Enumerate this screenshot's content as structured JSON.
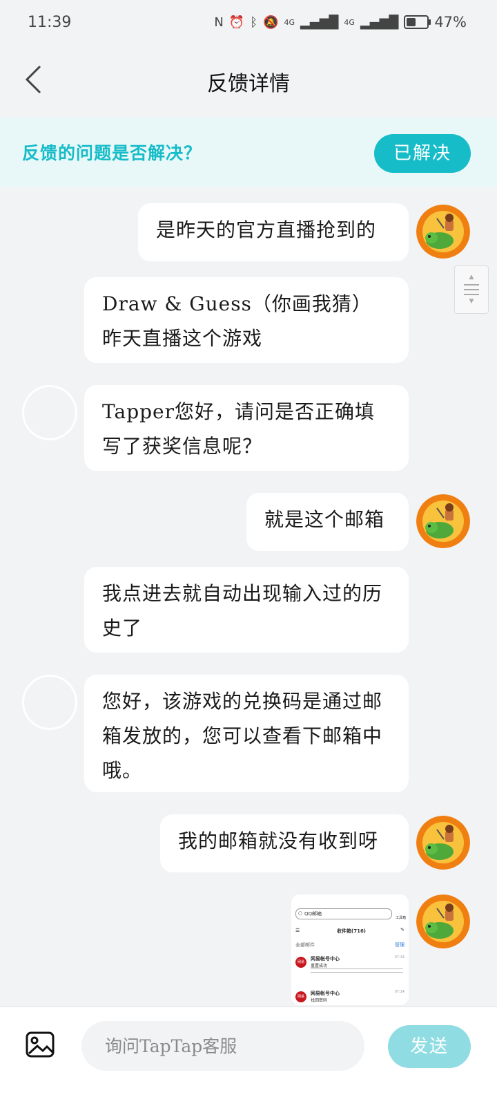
{
  "status_bar": {
    "time": "11:39",
    "signal_1": "4G",
    "signal_2": "4G",
    "battery_percent": "47%",
    "battery_level": 0.47
  },
  "header": {
    "title": "反馈详情"
  },
  "resolve": {
    "question": "反馈的问题是否解决？",
    "button": "已解决"
  },
  "messages": [
    {
      "from": "user",
      "text": "是昨天的官方直播抢到的"
    },
    {
      "from": "user",
      "text": "Draw & Guess（你画我猜）昨天直播这个游戏"
    },
    {
      "from": "agent",
      "text": "Tapper您好，请问是否正确填写了获奖信息呢？"
    },
    {
      "from": "user",
      "text": "就是这个邮箱"
    },
    {
      "from": "user",
      "text": "我点进去就自动出现输入过的历史了"
    },
    {
      "from": "agent",
      "text": "您好，该游戏的兑换码是通过邮箱发放的，您可以查看下邮箱中哦。"
    },
    {
      "from": "user",
      "text": "我的邮箱就没有收到呀"
    }
  ],
  "screenshot_message": {
    "search": "QQ邮箱",
    "folder": "收件箱(716)",
    "filter": "全部邮件",
    "manage": "管理",
    "toolbar": "工具箱",
    "mails": [
      {
        "badge": "网易",
        "sender": "网易帐号中心",
        "subject": "重置成功",
        "time": "07:14"
      },
      {
        "badge": "网易",
        "sender": "网易帐号中心",
        "subject": "找回密码",
        "time": "07:14"
      }
    ]
  },
  "footer": {
    "placeholder": "询问TapTap客服",
    "send": "发送"
  },
  "colors": {
    "accent": "#16bcc8",
    "accent_light": "#e8f8f9",
    "send_disabled": "#8fdde3",
    "page_bg": "#f2f3f5"
  }
}
